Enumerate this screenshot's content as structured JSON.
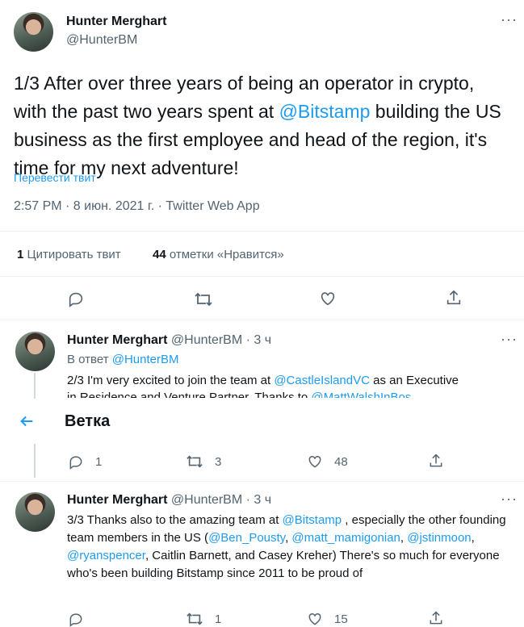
{
  "main_tweet": {
    "author_name": "Hunter Merghart",
    "author_handle": "@HunterBM",
    "text_part1": "1/3 After over three years of being an operator in crypto, with the past two years spent at ",
    "mention": "@Bitstamp",
    "text_part2": " building the US business as the first employee and head of the region, it's time for my next adventure!",
    "translate_label": "Перевести твит",
    "meta": "2:57 PM · 8 июн. 2021 г. · Twitter Web App",
    "quote_count": "1",
    "quote_label": "Цитировать твит",
    "like_count": "44",
    "like_label": "отметки «Нравится»"
  },
  "reply1": {
    "author_name": "Hunter Merghart",
    "author_handle": "@HunterBM",
    "time": "· 3 ч",
    "reply_to_prefix": "В ответ",
    "reply_to_handle": "@HunterBM",
    "text_part1": "2/3 I'm very excited to join the team at ",
    "mention1": "@CastleIslandVC",
    "text_part2": "  as an Executive",
    "text_line2_part1": "in Residence and Venture Partner. Thanks to ",
    "mention2": "@MattWalshInBos",
    "reply_count": "1",
    "retweet_count": "3",
    "like_count": "48"
  },
  "header": {
    "title": "Ветка"
  },
  "reply2": {
    "author_name": "Hunter Merghart",
    "author_handle": "@HunterBM",
    "time": "· 3 ч",
    "t1": "3/3 Thanks also to the amazing team at ",
    "m1": "@Bitstamp",
    "t2": " , especially the other founding team members in the US (",
    "m2": "@Ben_Pousty",
    "t3": ", ",
    "m3": "@matt_mamigonian",
    "t4": ", ",
    "m4": "@jstinmoon",
    "t5": ", ",
    "m5": "@ryanspencer",
    "t6": ", Caitlin Barnett, and Casey Kreher) There's so much for everyone who's been building Bitstamp since 2011 to be proud of",
    "retweet_count": "1",
    "like_count": "15"
  },
  "colors": {
    "accent": "#1d9bf0",
    "muted": "#536471",
    "divider": "#eff3f4"
  },
  "icons": [
    "reply-icon",
    "retweet-icon",
    "like-icon",
    "share-icon",
    "more-icon",
    "back-arrow-icon"
  ]
}
